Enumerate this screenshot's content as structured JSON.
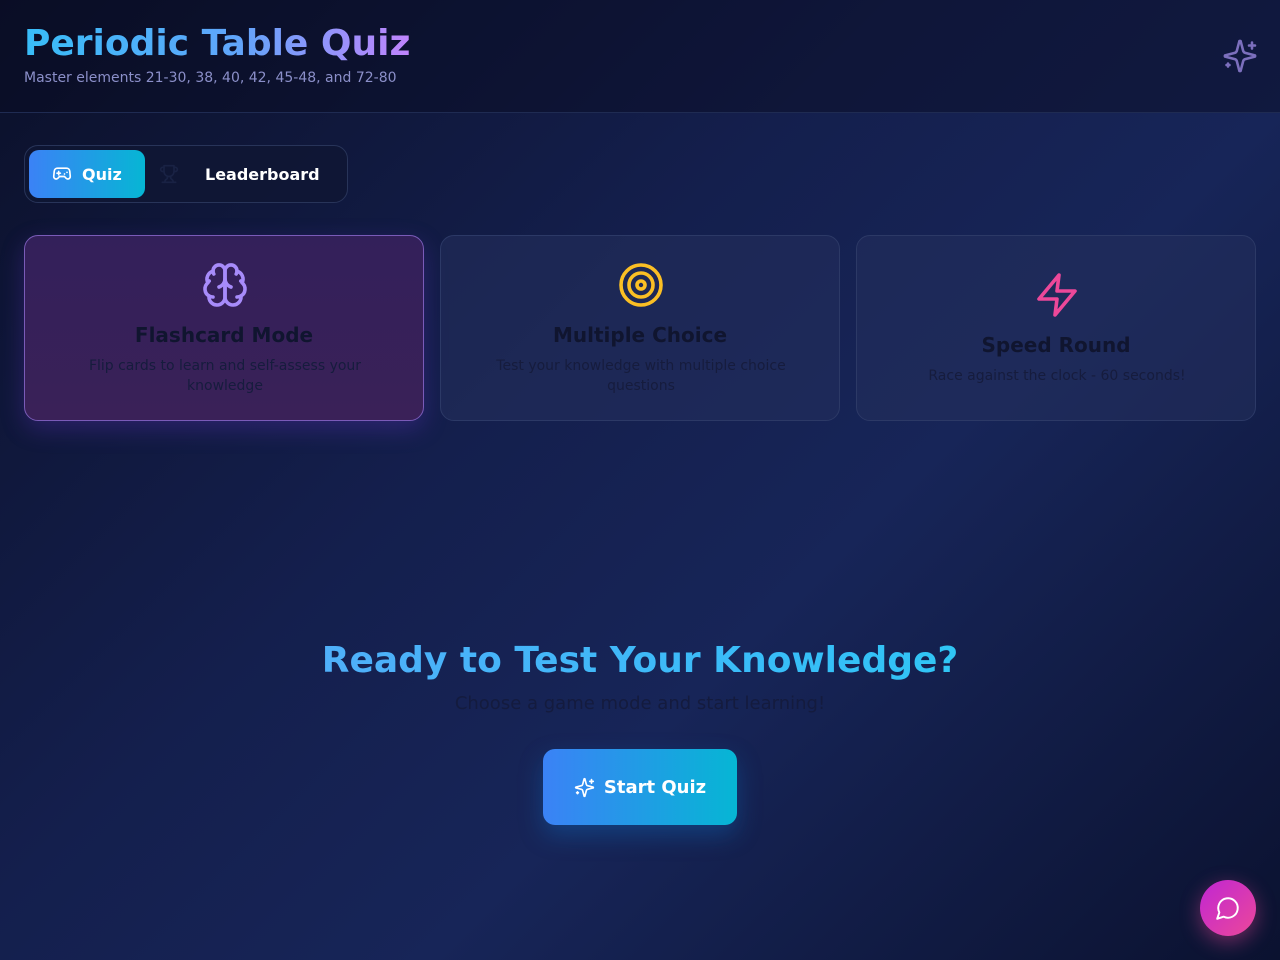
{
  "header": {
    "title": "Periodic Table Quiz",
    "subtitle": "Master elements 21-30, 38, 40, 42, 45-48, and 72-80",
    "icon": "sparkles-icon"
  },
  "tabs": [
    {
      "label": "Quiz",
      "icon": "gamepad-icon",
      "active": true
    },
    {
      "label": "Leaderboard",
      "icon": "trophy-icon",
      "active": false
    }
  ],
  "modes": [
    {
      "title": "Flashcard Mode",
      "description": "Flip cards to learn and self-assess your knowledge",
      "icon": "brain-icon",
      "color": "#a78bfa",
      "selected": true
    },
    {
      "title": "Multiple Choice",
      "description": "Test your knowledge with multiple choice questions",
      "icon": "target-icon",
      "color": "#fbbf24",
      "selected": false
    },
    {
      "title": "Speed Round",
      "description": "Race against the clock - 60 seconds!",
      "icon": "zap-icon",
      "color": "#ec4899",
      "selected": false
    }
  ],
  "hero": {
    "title": "Ready to Test Your Knowledge?",
    "subtitle": "Choose a game mode and start learning!"
  },
  "start_button": {
    "label": "Start Quiz",
    "icon": "sparkles-icon"
  },
  "chat_button": {
    "icon": "message-circle-icon"
  },
  "colors": {
    "accent_blue": "#3b82f6",
    "accent_cyan": "#06b6d4",
    "accent_purple": "#a78bfa",
    "chat_pink": "#ec4899"
  }
}
